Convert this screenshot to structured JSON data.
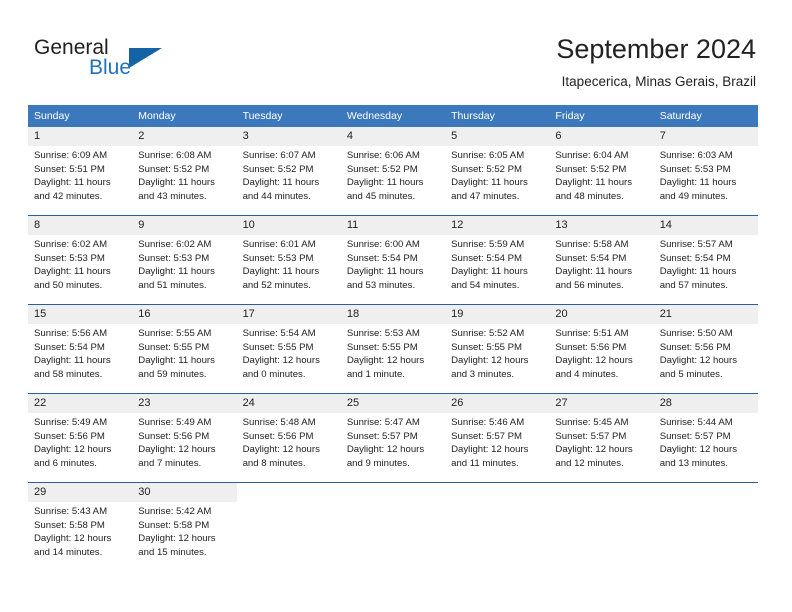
{
  "brand": {
    "name_part1": "General",
    "name_part2": "Blue",
    "triangle_color": "#1464a5",
    "blue_color": "#1e73be"
  },
  "header": {
    "title": "September 2024",
    "location": "Itapecerica, Minas Gerais, Brazil"
  },
  "theme": {
    "header_row_bg": "#3b78bc",
    "daynum_strip_bg": "#efefef",
    "row_divider": "#2a6099",
    "text_color": "#222222"
  },
  "weekdays": [
    "Sunday",
    "Monday",
    "Tuesday",
    "Wednesday",
    "Thursday",
    "Friday",
    "Saturday"
  ],
  "weeks": [
    [
      {
        "day": "1",
        "sunrise": "Sunrise: 6:09 AM",
        "sunset": "Sunset: 5:51 PM",
        "daylight1": "Daylight: 11 hours",
        "daylight2": "and 42 minutes."
      },
      {
        "day": "2",
        "sunrise": "Sunrise: 6:08 AM",
        "sunset": "Sunset: 5:52 PM",
        "daylight1": "Daylight: 11 hours",
        "daylight2": "and 43 minutes."
      },
      {
        "day": "3",
        "sunrise": "Sunrise: 6:07 AM",
        "sunset": "Sunset: 5:52 PM",
        "daylight1": "Daylight: 11 hours",
        "daylight2": "and 44 minutes."
      },
      {
        "day": "4",
        "sunrise": "Sunrise: 6:06 AM",
        "sunset": "Sunset: 5:52 PM",
        "daylight1": "Daylight: 11 hours",
        "daylight2": "and 45 minutes."
      },
      {
        "day": "5",
        "sunrise": "Sunrise: 6:05 AM",
        "sunset": "Sunset: 5:52 PM",
        "daylight1": "Daylight: 11 hours",
        "daylight2": "and 47 minutes."
      },
      {
        "day": "6",
        "sunrise": "Sunrise: 6:04 AM",
        "sunset": "Sunset: 5:52 PM",
        "daylight1": "Daylight: 11 hours",
        "daylight2": "and 48 minutes."
      },
      {
        "day": "7",
        "sunrise": "Sunrise: 6:03 AM",
        "sunset": "Sunset: 5:53 PM",
        "daylight1": "Daylight: 11 hours",
        "daylight2": "and 49 minutes."
      }
    ],
    [
      {
        "day": "8",
        "sunrise": "Sunrise: 6:02 AM",
        "sunset": "Sunset: 5:53 PM",
        "daylight1": "Daylight: 11 hours",
        "daylight2": "and 50 minutes."
      },
      {
        "day": "9",
        "sunrise": "Sunrise: 6:02 AM",
        "sunset": "Sunset: 5:53 PM",
        "daylight1": "Daylight: 11 hours",
        "daylight2": "and 51 minutes."
      },
      {
        "day": "10",
        "sunrise": "Sunrise: 6:01 AM",
        "sunset": "Sunset: 5:53 PM",
        "daylight1": "Daylight: 11 hours",
        "daylight2": "and 52 minutes."
      },
      {
        "day": "11",
        "sunrise": "Sunrise: 6:00 AM",
        "sunset": "Sunset: 5:54 PM",
        "daylight1": "Daylight: 11 hours",
        "daylight2": "and 53 minutes."
      },
      {
        "day": "12",
        "sunrise": "Sunrise: 5:59 AM",
        "sunset": "Sunset: 5:54 PM",
        "daylight1": "Daylight: 11 hours",
        "daylight2": "and 54 minutes."
      },
      {
        "day": "13",
        "sunrise": "Sunrise: 5:58 AM",
        "sunset": "Sunset: 5:54 PM",
        "daylight1": "Daylight: 11 hours",
        "daylight2": "and 56 minutes."
      },
      {
        "day": "14",
        "sunrise": "Sunrise: 5:57 AM",
        "sunset": "Sunset: 5:54 PM",
        "daylight1": "Daylight: 11 hours",
        "daylight2": "and 57 minutes."
      }
    ],
    [
      {
        "day": "15",
        "sunrise": "Sunrise: 5:56 AM",
        "sunset": "Sunset: 5:54 PM",
        "daylight1": "Daylight: 11 hours",
        "daylight2": "and 58 minutes."
      },
      {
        "day": "16",
        "sunrise": "Sunrise: 5:55 AM",
        "sunset": "Sunset: 5:55 PM",
        "daylight1": "Daylight: 11 hours",
        "daylight2": "and 59 minutes."
      },
      {
        "day": "17",
        "sunrise": "Sunrise: 5:54 AM",
        "sunset": "Sunset: 5:55 PM",
        "daylight1": "Daylight: 12 hours",
        "daylight2": "and 0 minutes."
      },
      {
        "day": "18",
        "sunrise": "Sunrise: 5:53 AM",
        "sunset": "Sunset: 5:55 PM",
        "daylight1": "Daylight: 12 hours",
        "daylight2": "and 1 minute."
      },
      {
        "day": "19",
        "sunrise": "Sunrise: 5:52 AM",
        "sunset": "Sunset: 5:55 PM",
        "daylight1": "Daylight: 12 hours",
        "daylight2": "and 3 minutes."
      },
      {
        "day": "20",
        "sunrise": "Sunrise: 5:51 AM",
        "sunset": "Sunset: 5:56 PM",
        "daylight1": "Daylight: 12 hours",
        "daylight2": "and 4 minutes."
      },
      {
        "day": "21",
        "sunrise": "Sunrise: 5:50 AM",
        "sunset": "Sunset: 5:56 PM",
        "daylight1": "Daylight: 12 hours",
        "daylight2": "and 5 minutes."
      }
    ],
    [
      {
        "day": "22",
        "sunrise": "Sunrise: 5:49 AM",
        "sunset": "Sunset: 5:56 PM",
        "daylight1": "Daylight: 12 hours",
        "daylight2": "and 6 minutes."
      },
      {
        "day": "23",
        "sunrise": "Sunrise: 5:49 AM",
        "sunset": "Sunset: 5:56 PM",
        "daylight1": "Daylight: 12 hours",
        "daylight2": "and 7 minutes."
      },
      {
        "day": "24",
        "sunrise": "Sunrise: 5:48 AM",
        "sunset": "Sunset: 5:56 PM",
        "daylight1": "Daylight: 12 hours",
        "daylight2": "and 8 minutes."
      },
      {
        "day": "25",
        "sunrise": "Sunrise: 5:47 AM",
        "sunset": "Sunset: 5:57 PM",
        "daylight1": "Daylight: 12 hours",
        "daylight2": "and 9 minutes."
      },
      {
        "day": "26",
        "sunrise": "Sunrise: 5:46 AM",
        "sunset": "Sunset: 5:57 PM",
        "daylight1": "Daylight: 12 hours",
        "daylight2": "and 11 minutes."
      },
      {
        "day": "27",
        "sunrise": "Sunrise: 5:45 AM",
        "sunset": "Sunset: 5:57 PM",
        "daylight1": "Daylight: 12 hours",
        "daylight2": "and 12 minutes."
      },
      {
        "day": "28",
        "sunrise": "Sunrise: 5:44 AM",
        "sunset": "Sunset: 5:57 PM",
        "daylight1": "Daylight: 12 hours",
        "daylight2": "and 13 minutes."
      }
    ],
    [
      {
        "day": "29",
        "sunrise": "Sunrise: 5:43 AM",
        "sunset": "Sunset: 5:58 PM",
        "daylight1": "Daylight: 12 hours",
        "daylight2": "and 14 minutes."
      },
      {
        "day": "30",
        "sunrise": "Sunrise: 5:42 AM",
        "sunset": "Sunset: 5:58 PM",
        "daylight1": "Daylight: 12 hours",
        "daylight2": "and 15 minutes."
      },
      {
        "day": "",
        "sunrise": "",
        "sunset": "",
        "daylight1": "",
        "daylight2": ""
      },
      {
        "day": "",
        "sunrise": "",
        "sunset": "",
        "daylight1": "",
        "daylight2": ""
      },
      {
        "day": "",
        "sunrise": "",
        "sunset": "",
        "daylight1": "",
        "daylight2": ""
      },
      {
        "day": "",
        "sunrise": "",
        "sunset": "",
        "daylight1": "",
        "daylight2": ""
      },
      {
        "day": "",
        "sunrise": "",
        "sunset": "",
        "daylight1": "",
        "daylight2": ""
      }
    ]
  ]
}
